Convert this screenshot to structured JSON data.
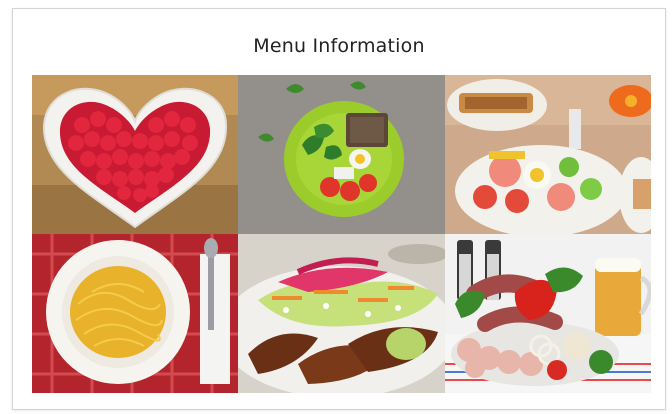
{
  "header": {
    "title": "Menu Information"
  },
  "menu": {
    "items": [
      {
        "icon": "raspberries-heart-bowl-image"
      },
      {
        "icon": "green-plate-salad-bread-image"
      },
      {
        "icon": "mixed-salad-platter-image"
      },
      {
        "icon": "spaghetti-plate-image"
      },
      {
        "icon": "enchiladas-salsa-plate-image"
      },
      {
        "icon": "sausages-beer-platter-image"
      }
    ]
  }
}
